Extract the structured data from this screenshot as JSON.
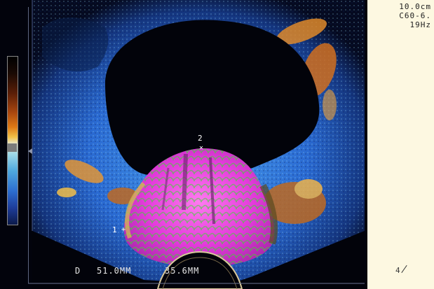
{
  "scan_params": {
    "depth": "10.0cm",
    "probe": "C60-6.",
    "frequency": "19Hz"
  },
  "measurement": {
    "label": "D",
    "d1": "51.0MM",
    "d2": "35.6MM"
  },
  "calipers": {
    "marker1": "1",
    "marker2": "2",
    "cross": "×",
    "plus": "+"
  },
  "frame": {
    "number": "4"
  },
  "colors": {
    "background": "#02030c",
    "sidebar": "#fdf8e1",
    "magenta": "#e83be0",
    "green": "#33e02a",
    "blue": "#2b6fd8",
    "orange": "#e68a2a"
  }
}
